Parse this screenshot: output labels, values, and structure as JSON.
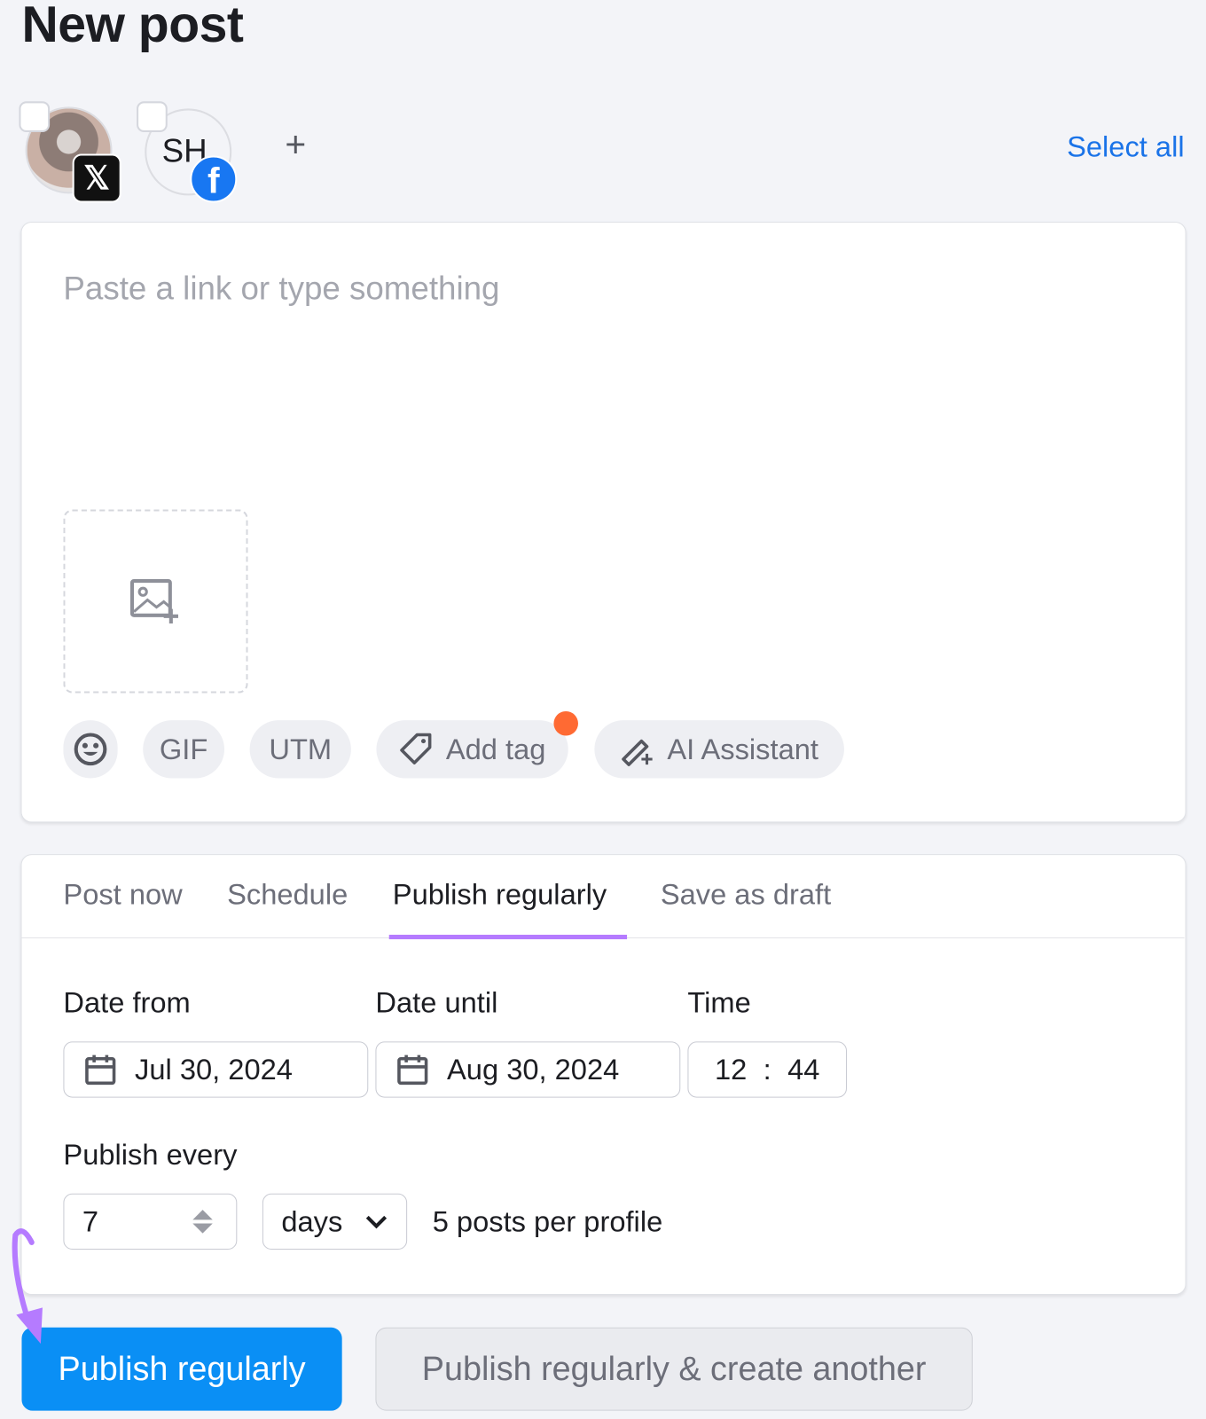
{
  "page_title": "New post",
  "profiles": [
    {
      "name": "profile-x",
      "network": "x-icon",
      "checked": false
    },
    {
      "name": "profile-sh",
      "initials": "SH",
      "network": "facebook-icon",
      "checked": false
    }
  ],
  "add_profile": "+",
  "select_all": "Select all",
  "editor": {
    "placeholder": "Paste a link or type something",
    "toolbar": {
      "gif": "GIF",
      "utm": "UTM",
      "add_tag": "Add tag",
      "ai_assistant": "AI Assistant"
    }
  },
  "tabs": [
    {
      "label": "Post now",
      "active": false
    },
    {
      "label": "Schedule",
      "active": false
    },
    {
      "label": "Publish regularly",
      "active": true
    },
    {
      "label": "Save as draft",
      "active": false
    }
  ],
  "form": {
    "date_from_label": "Date from",
    "date_from": "Jul 30, 2024",
    "date_until_label": "Date until",
    "date_until": "Aug 30, 2024",
    "time_label": "Time",
    "hour": "12",
    "separator": ":",
    "minute": "44",
    "publish_every_label": "Publish every",
    "interval": "7",
    "unit": "days",
    "summary": "5 posts per profile"
  },
  "buttons": {
    "primary": "Publish regularly",
    "secondary": "Publish regularly & create another"
  },
  "colors": {
    "accent": "#0a8ff5",
    "link": "#1a73e8",
    "tab_underline": "#b57bff",
    "badge": "#ff6a33",
    "arrow": "#b57bff"
  }
}
